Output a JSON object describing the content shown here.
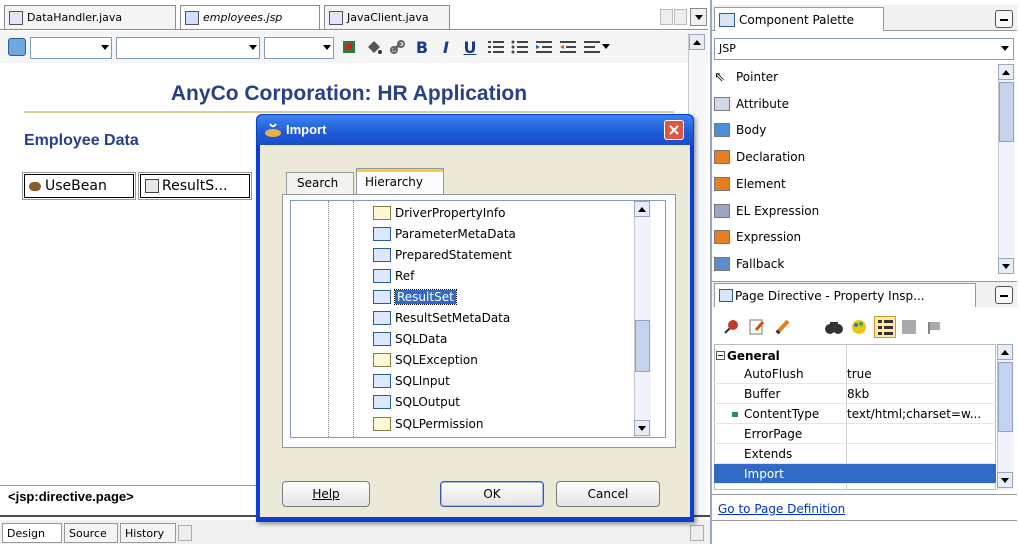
{
  "editor": {
    "tabs": [
      "DataHandler.java",
      "employees.jsp",
      "JavaClient.java"
    ],
    "title": "AnyCo Corporation: HR Application",
    "heading": "Employee Data",
    "usebean_label": "UseBean",
    "resultset_label": "ResultS...",
    "status_tag": "<jsp:directive.page>",
    "bottom_tabs": [
      "Design",
      "Source",
      "History"
    ]
  },
  "toolbar": {
    "bold": "B",
    "italic": "I",
    "underline": "U"
  },
  "dialog": {
    "title": "Import",
    "tabs": [
      "Search",
      "Hierarchy"
    ],
    "tree_items": [
      {
        "label": "DriverPropertyInfo",
        "kind": "class"
      },
      {
        "label": "ParameterMetaData",
        "kind": "interface"
      },
      {
        "label": "PreparedStatement",
        "kind": "interface"
      },
      {
        "label": "Ref",
        "kind": "interface"
      },
      {
        "label": "ResultSet",
        "kind": "interface",
        "selected": true
      },
      {
        "label": "ResultSetMetaData",
        "kind": "interface"
      },
      {
        "label": "SQLData",
        "kind": "interface"
      },
      {
        "label": "SQLException",
        "kind": "class"
      },
      {
        "label": "SQLInput",
        "kind": "interface"
      },
      {
        "label": "SQLOutput",
        "kind": "interface"
      },
      {
        "label": "SQLPermission",
        "kind": "class"
      }
    ],
    "help_label": "Help",
    "ok_label": "OK",
    "cancel_label": "Cancel"
  },
  "palette": {
    "title": "Component Palette",
    "category": "JSP",
    "items": [
      "Pointer",
      "Attribute",
      "Body",
      "Declaration",
      "Element",
      "EL Expression",
      "Expression",
      "Fallback"
    ]
  },
  "inspector": {
    "title": "Page Directive - Property Insp...",
    "group": "General",
    "rows": [
      {
        "key": "AutoFlush",
        "value": "true"
      },
      {
        "key": "Buffer",
        "value": "8kb"
      },
      {
        "key": "ContentType",
        "value": "text/html;charset=w..."
      },
      {
        "key": "ErrorPage",
        "value": ""
      },
      {
        "key": "Extends",
        "value": ""
      },
      {
        "key": "Import",
        "value": "",
        "selected": true
      }
    ],
    "link": "Go to Page Definition"
  },
  "colors": {
    "accent": "#0a246a",
    "selection": "#316ac5",
    "dialog_title": "#2457c8",
    "title_text": "#27408b"
  }
}
